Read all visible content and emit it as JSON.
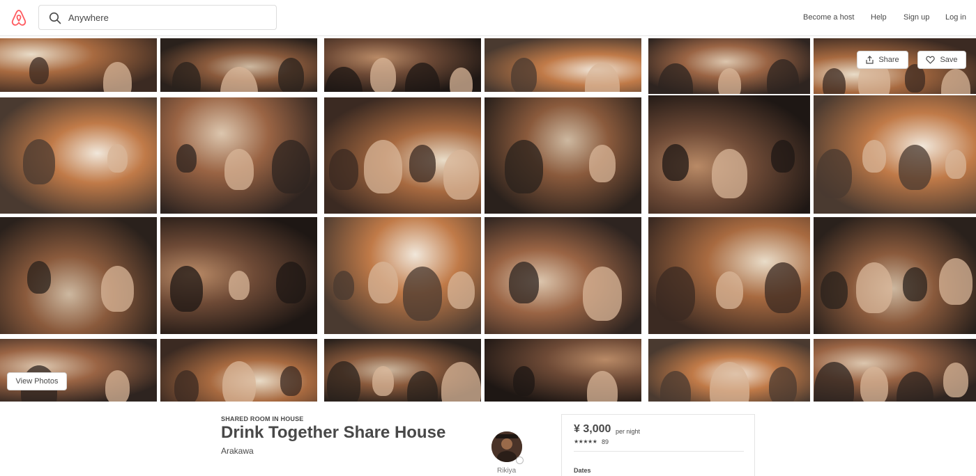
{
  "header": {
    "search_placeholder": "Anywhere",
    "nav": {
      "become_host": "Become a host",
      "help": "Help",
      "sign_up": "Sign up",
      "log_in": "Log in"
    }
  },
  "gallery": {
    "share_label": "Share",
    "save_label": "Save",
    "view_photos_label": "View Photos"
  },
  "listing": {
    "type": "SHARED ROOM IN HOUSE",
    "title": "Drink Together Share House",
    "location": "Arakawa",
    "host_name": "Rikiya"
  },
  "booking": {
    "price": "¥ 3,000",
    "per_night": "per night",
    "stars": "★★★★★",
    "review_count": "89",
    "dates_label": "Dates"
  },
  "colors": {
    "brand": "#FF5A5F",
    "text": "#484848",
    "photo_tint": "#b8622e"
  },
  "icons": [
    "airbnb-logo",
    "search-icon",
    "share-icon",
    "heart-icon"
  ]
}
